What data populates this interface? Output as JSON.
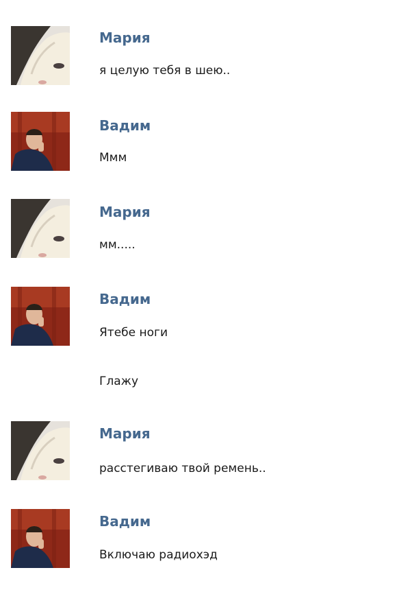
{
  "messages": [
    {
      "author": "Мария",
      "lines": [
        "я целую тебя в шею.."
      ]
    },
    {
      "author": "Вадим",
      "lines": [
        "Ммм"
      ]
    },
    {
      "author": "Мария",
      "lines": [
        "мм....."
      ]
    },
    {
      "author": "Вадим",
      "lines": [
        "Ятебе ноги",
        "Глажу"
      ]
    },
    {
      "author": "Мария",
      "lines": [
        "расстегиваю твой ремень.."
      ]
    },
    {
      "author": "Вадим",
      "lines": [
        "Включаю радиохэд"
      ]
    }
  ],
  "colors": {
    "author_name": "#45688e",
    "message_text": "#1a1a1a",
    "background": "#ffffff"
  },
  "icons": {
    "maria_avatar": "blonde-woman-avatar",
    "vadim_avatar": "man-on-red-background-avatar"
  }
}
